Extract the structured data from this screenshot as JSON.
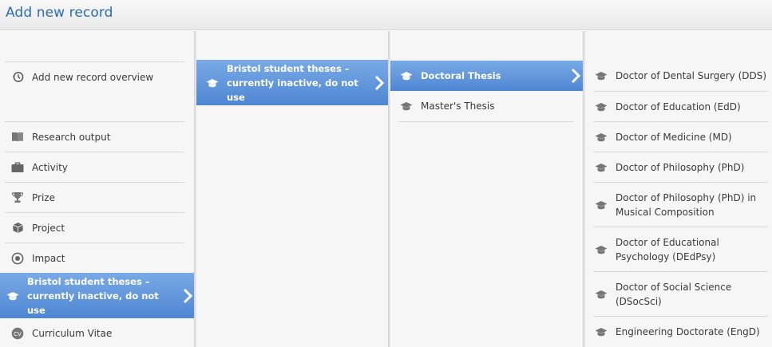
{
  "header": {
    "title": "Add new record"
  },
  "column1": {
    "overview": {
      "label": "Add new record overview",
      "icon": "history-icon"
    },
    "items": [
      {
        "label": "Research output",
        "icon": "book-icon"
      },
      {
        "label": "Activity",
        "icon": "briefcase-icon"
      },
      {
        "label": "Prize",
        "icon": "trophy-icon"
      },
      {
        "label": "Project",
        "icon": "cube-icon"
      },
      {
        "label": "Impact",
        "icon": "target-icon"
      },
      {
        "label": "Bristol student theses – currently inactive, do not use",
        "icon": "graduation-cap-icon",
        "selected": true
      },
      {
        "label": "Curriculum Vitae",
        "icon": "cv-icon"
      }
    ]
  },
  "column2": {
    "items": [
      {
        "label": "Bristol student theses – currently inactive, do not use",
        "icon": "graduation-cap-icon",
        "selected": true
      }
    ]
  },
  "column3": {
    "items": [
      {
        "label": "Doctoral Thesis",
        "icon": "graduation-cap-icon",
        "selected": true
      },
      {
        "label": "Master's Thesis",
        "icon": "graduation-cap-icon"
      }
    ]
  },
  "column4": {
    "items": [
      {
        "label": "Doctor of Dental Surgery (DDS)",
        "icon": "graduation-cap-icon"
      },
      {
        "label": "Doctor of Education (EdD)",
        "icon": "graduation-cap-icon"
      },
      {
        "label": "Doctor of Medicine (MD)",
        "icon": "graduation-cap-icon"
      },
      {
        "label": "Doctor of Philosophy (PhD)",
        "icon": "graduation-cap-icon"
      },
      {
        "label": "Doctor of Philosophy (PhD) in Musical Composition",
        "icon": "graduation-cap-icon"
      },
      {
        "label": "Doctor of Educational Psychology (DEdPsy)",
        "icon": "graduation-cap-icon"
      },
      {
        "label": "Doctor of Social Science (DSocSci)",
        "icon": "graduation-cap-icon"
      },
      {
        "label": "Engineering Doctorate (EngD)",
        "icon": "graduation-cap-icon"
      }
    ]
  },
  "colors": {
    "accent": "#2a6db5",
    "selected_top": "#79aae6",
    "selected_bottom": "#4e86d2"
  }
}
